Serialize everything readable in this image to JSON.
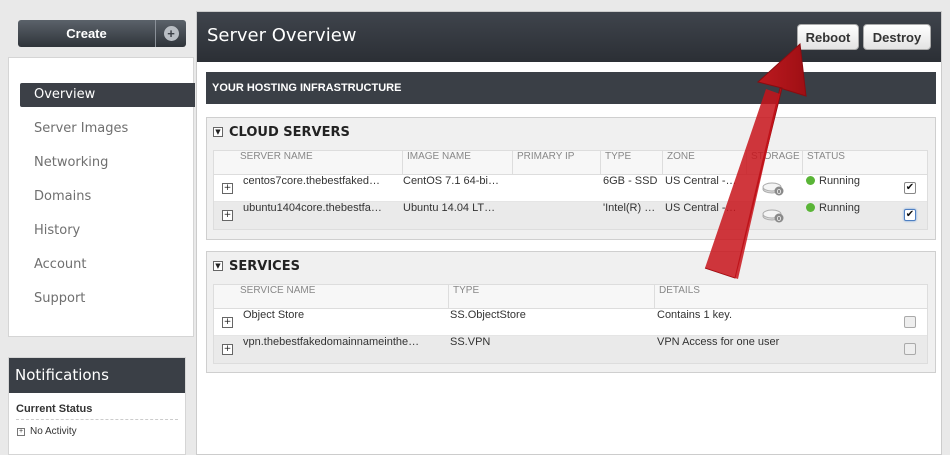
{
  "sidebar": {
    "create_label": "Create",
    "nav": [
      "Overview",
      "Server Images",
      "Networking",
      "Domains",
      "History",
      "Account",
      "Support"
    ],
    "active": "Overview"
  },
  "notifications": {
    "title": "Notifications",
    "subtitle": "Current Status",
    "item": "No Activity"
  },
  "header": {
    "title": "Server Overview",
    "reboot_label": "Reboot",
    "destroy_label": "Destroy"
  },
  "infra_title": "YOUR HOSTING INFRASTRUCTURE",
  "cloud_servers": {
    "title": "CLOUD SERVERS",
    "columns": [
      "SERVER NAME",
      "IMAGE NAME",
      "PRIMARY IP",
      "TYPE",
      "ZONE",
      "STORAGE",
      "STATUS"
    ],
    "rows": [
      {
        "name": "centos7core.thebestfaked…",
        "image": "CentOS 7.1 64-bi…",
        "ip": "",
        "type": "6GB - SSD",
        "zone": "US Central -…",
        "status": "Running",
        "checked": true
      },
      {
        "name": "ubuntu1404core.thebestfa…",
        "image": "Ubuntu 14.04 LT…",
        "ip": "",
        "type": "'Intel(R) …",
        "zone": "US Central -…",
        "status": "Running",
        "checked": true
      }
    ]
  },
  "services": {
    "title": "SERVICES",
    "columns": [
      "SERVICE NAME",
      "TYPE",
      "DETAILS"
    ],
    "rows": [
      {
        "name": "Object Store",
        "type": "SS.ObjectStore",
        "details": "Contains 1 key."
      },
      {
        "name": "vpn.thebestfakedomainnameinthe…",
        "type": "SS.VPN",
        "details": "VPN Access for one user"
      }
    ]
  },
  "colors": {
    "dark_header": "#3a3f46",
    "status_green": "#5ab537",
    "annotation_arrow": "#c8141b"
  },
  "icons": {
    "expand": "plus-box-icon",
    "collapse": "triangle-down-icon",
    "storage": "disk-icon",
    "status": "green-dot-icon"
  }
}
